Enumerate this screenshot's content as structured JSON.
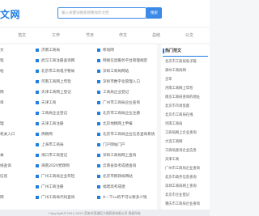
{
  "header": {
    "logo_text": "文网",
    "search_placeholder": "输入关键词搜索想要找的文档",
    "search_button": "搜索"
  },
  "nav": [
    "范文",
    "工作",
    "节日",
    "作文",
    "总结",
    "公文"
  ],
  "columns": {
    "a": [
      "文",
      "程",
      "帖",
      "",
      "网",
      "单",
      "",
      "理",
      "机关入口",
      "",
      "录",
      "线查询",
      "信息",
      "",
      "网"
    ],
    "b": [
      "济南工商局",
      "武汉工商注册查询网",
      "北京市工商电子税局",
      "河南工商网上年检",
      "天津工商网上登记",
      "天津工商",
      "工商局企业登记",
      "天津工商注册",
      "佛教网",
      "上海市工商局",
      "海口市工商登记",
      "海南2020党政网",
      "广州工商局企业年检",
      "广州工商注册",
      "广州工商局代码查询"
    ],
    "c": [
      "移动网",
      "网络信息服务平台管理规定",
      "深圳工商局网站",
      "深圳市数字化管理入口",
      "工商局企业登记",
      "广州市工商局企业查询",
      "北京市工商局企业注册",
      "北京地税网上申报",
      "北京市工商局企业信息查询系统",
      "门户网站门户",
      "深圳工商局网上查询",
      "云南省高考成绩查询",
      "北京市民政局网站",
      "福建高考成绩",
      "A—下cu的不可以要多少钱"
    ]
  },
  "sidebar": {
    "title": "热门范文",
    "items": [
      "北京市工商局电子版",
      "郑州工商局网",
      "全年",
      "河南工商网上年检",
      "南京工商局查询的地址",
      "北京市市场监督",
      "北京市工商局在线",
      "河南工商局",
      "工商局网上企业查询",
      "大连工商网",
      "工商局查询企业信息",
      "天津工商",
      "广州市工商局企业查询",
      "北京市政务信息查询",
      "深圳工商局网上查询",
      "北京市企业登记",
      "重庆市工商局企业查询"
    ]
  },
  "footer": {
    "text": "Copyright©2021-2023  西安市莲湖区大福贸易有限公司 版权所有"
  },
  "colors": {
    "accent": "#1e7de0",
    "page_bg": "#f5f6f8"
  }
}
